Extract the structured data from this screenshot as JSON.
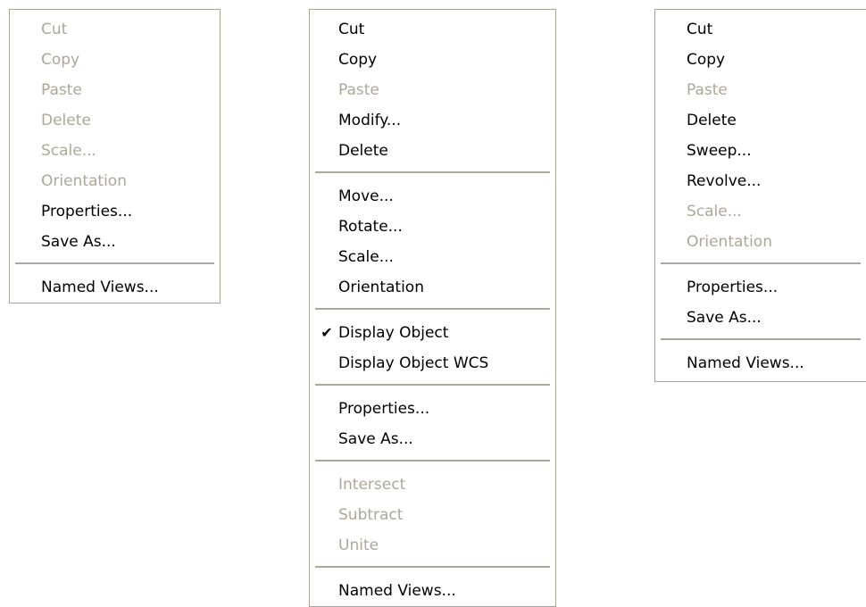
{
  "menus": [
    {
      "id": "menu-1",
      "items": [
        {
          "type": "item",
          "label": "Cut",
          "enabled": false
        },
        {
          "type": "item",
          "label": "Copy",
          "enabled": false
        },
        {
          "type": "item",
          "label": "Paste",
          "enabled": false
        },
        {
          "type": "item",
          "label": "Delete",
          "enabled": false
        },
        {
          "type": "item",
          "label": "Scale...",
          "enabled": false
        },
        {
          "type": "item",
          "label": "Orientation",
          "enabled": false
        },
        {
          "type": "item",
          "label": "Properties...",
          "enabled": true
        },
        {
          "type": "item",
          "label": "Save As...",
          "enabled": true
        },
        {
          "type": "separator"
        },
        {
          "type": "item",
          "label": "Named Views...",
          "enabled": true
        }
      ]
    },
    {
      "id": "menu-2",
      "items": [
        {
          "type": "item",
          "label": "Cut",
          "enabled": true
        },
        {
          "type": "item",
          "label": "Copy",
          "enabled": true
        },
        {
          "type": "item",
          "label": "Paste",
          "enabled": false
        },
        {
          "type": "item",
          "label": "Modify...",
          "enabled": true
        },
        {
          "type": "item",
          "label": "Delete",
          "enabled": true
        },
        {
          "type": "separator"
        },
        {
          "type": "item",
          "label": "Move...",
          "enabled": true
        },
        {
          "type": "item",
          "label": "Rotate...",
          "enabled": true
        },
        {
          "type": "item",
          "label": "Scale...",
          "enabled": true
        },
        {
          "type": "item",
          "label": "Orientation",
          "enabled": true
        },
        {
          "type": "separator"
        },
        {
          "type": "item",
          "label": "Display Object",
          "enabled": true,
          "checked": true
        },
        {
          "type": "item",
          "label": "Display Object WCS",
          "enabled": true
        },
        {
          "type": "separator"
        },
        {
          "type": "item",
          "label": "Properties...",
          "enabled": true
        },
        {
          "type": "item",
          "label": "Save As...",
          "enabled": true
        },
        {
          "type": "separator"
        },
        {
          "type": "item",
          "label": "Intersect",
          "enabled": false
        },
        {
          "type": "item",
          "label": "Subtract",
          "enabled": false
        },
        {
          "type": "item",
          "label": "Unite",
          "enabled": false
        },
        {
          "type": "separator"
        },
        {
          "type": "item",
          "label": "Named Views...",
          "enabled": true
        }
      ]
    },
    {
      "id": "menu-3",
      "items": [
        {
          "type": "item",
          "label": "Cut",
          "enabled": true
        },
        {
          "type": "item",
          "label": "Copy",
          "enabled": true
        },
        {
          "type": "item",
          "label": "Paste",
          "enabled": false
        },
        {
          "type": "item",
          "label": "Delete",
          "enabled": true
        },
        {
          "type": "item",
          "label": "Sweep...",
          "enabled": true
        },
        {
          "type": "item",
          "label": "Revolve...",
          "enabled": true
        },
        {
          "type": "item",
          "label": "Scale...",
          "enabled": false
        },
        {
          "type": "item",
          "label": "Orientation",
          "enabled": false
        },
        {
          "type": "separator"
        },
        {
          "type": "item",
          "label": "Properties...",
          "enabled": true
        },
        {
          "type": "item",
          "label": "Save As...",
          "enabled": true
        },
        {
          "type": "separator"
        },
        {
          "type": "item",
          "label": "Named Views...",
          "enabled": true
        }
      ]
    }
  ],
  "icons": {
    "checkmark": "✔"
  },
  "colors": {
    "disabled_text": "#aca899",
    "enabled_text": "#000000",
    "border": "#a7a697"
  }
}
